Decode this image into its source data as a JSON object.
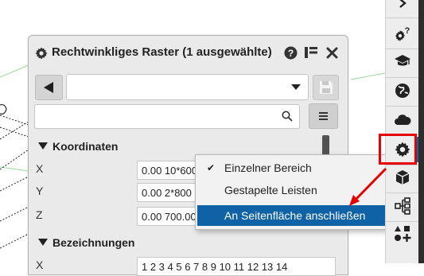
{
  "panel": {
    "title": "Rechtwinkliges Raster (1 ausgewählte)",
    "search": {
      "value": "",
      "placeholder": ""
    },
    "preset_value": "",
    "sections": {
      "coordinates": {
        "title": "Koordinaten",
        "rows": [
          {
            "label": "X",
            "value": "0.00 10*600"
          },
          {
            "label": "Y",
            "value": "0.00 2*800"
          },
          {
            "label": "Z",
            "value": "0.00 700.00"
          }
        ]
      },
      "labels": {
        "title": "Bezeichnungen",
        "rows": [
          {
            "label": "X",
            "value": "1 2 3 4 5 6 7 8 9 10 11 12 13 14"
          }
        ]
      }
    }
  },
  "context_menu": {
    "items": [
      {
        "label": "Einzelner Bereich",
        "checked": true,
        "highlighted": false
      },
      {
        "label": "Gestapelte Leisten",
        "checked": false,
        "highlighted": false
      },
      {
        "label": "An Seitenfläche anschließen",
        "checked": false,
        "highlighted": true
      }
    ]
  },
  "toolbar": {
    "buttons": [
      {
        "icon": "chevron-right-icon",
        "selected": false
      },
      {
        "icon": "gear-question-icon",
        "selected": false
      },
      {
        "icon": "graduation-cap-icon",
        "selected": false
      },
      {
        "icon": "globe-icon",
        "selected": false
      },
      {
        "icon": "cloud-icon",
        "selected": false
      },
      {
        "icon": "gear-icon",
        "selected": true
      },
      {
        "icon": "cube-icon",
        "selected": false
      },
      {
        "icon": "hierarchy-icon",
        "selected": false
      },
      {
        "icon": "shapes-add-icon",
        "selected": false
      }
    ]
  },
  "colors": {
    "highlight": "#0f62a6",
    "annotation": "#e60000",
    "panel_bg": "#eaeaea"
  }
}
